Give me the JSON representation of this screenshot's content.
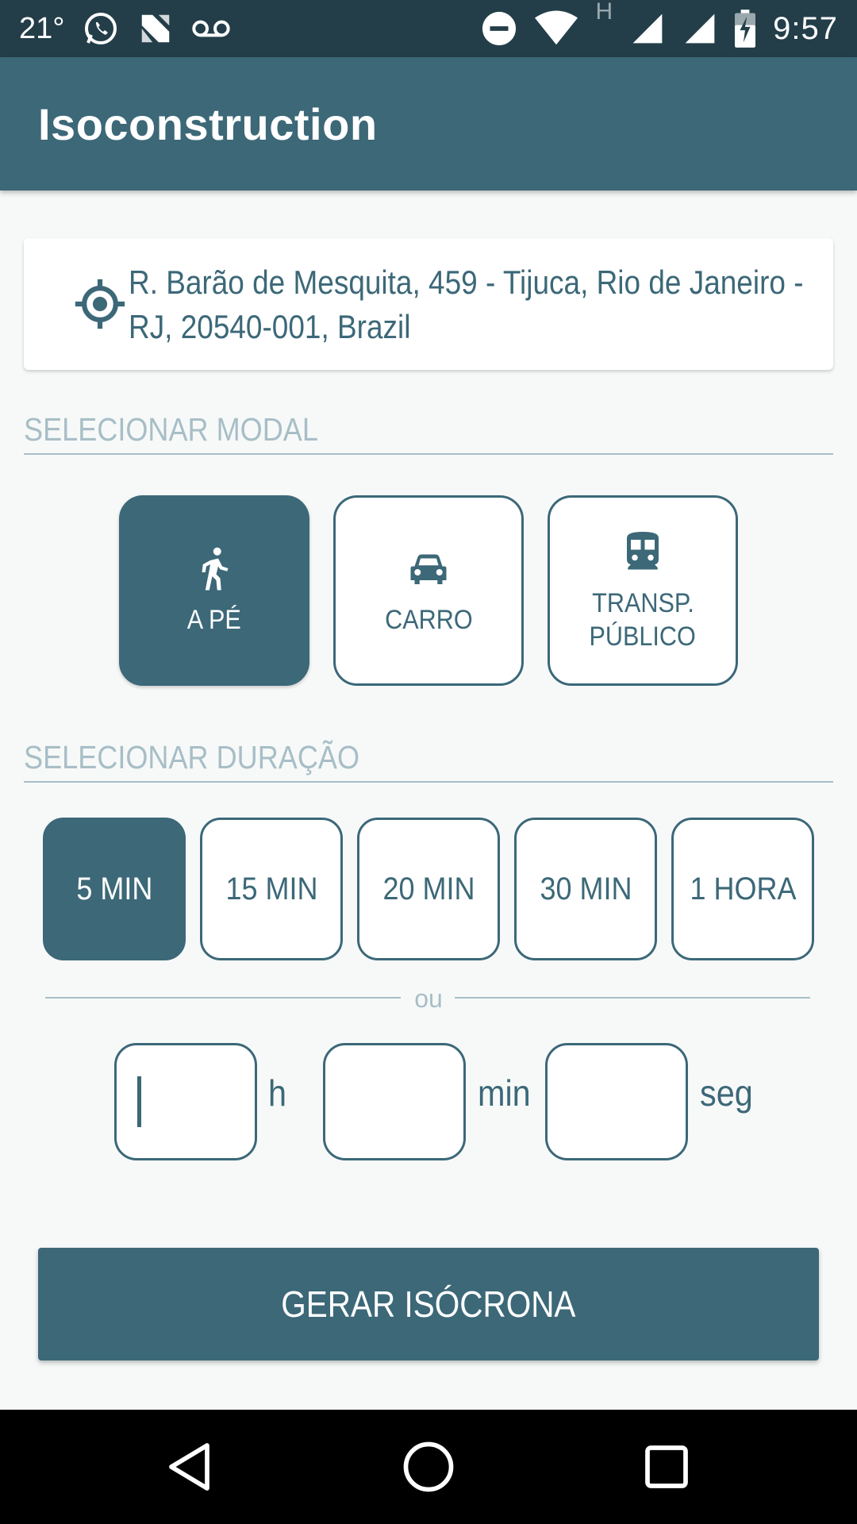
{
  "status_bar": {
    "temperature": "21°",
    "time": "9:57",
    "network_letter": "H",
    "icons": [
      "whatsapp-icon",
      "n-icon",
      "voicemail-icon",
      "dnd-icon",
      "wifi-icon",
      "signal-icon",
      "signal-icon-2",
      "battery-icon"
    ]
  },
  "app_bar": {
    "title": "Isoconstruction"
  },
  "address": {
    "value": "R. Barão de Mesquita, 459 - Tijuca, Rio de Janeiro - RJ, 20540-001, Brazil",
    "icon": "my-location-icon"
  },
  "modal_section": {
    "header": "SELECIONAR MODAL",
    "options": [
      {
        "label": "A PÉ",
        "icon": "walk-icon",
        "selected": true
      },
      {
        "label": "CARRO",
        "icon": "car-icon",
        "selected": false
      },
      {
        "label": "TRANSP. PÚBLICO",
        "label_line1": "TRANSP.",
        "label_line2": "PÚBLICO",
        "icon": "train-icon",
        "selected": false
      }
    ]
  },
  "duration_section": {
    "header": "SELECIONAR DURAÇÃO",
    "options": [
      {
        "label": "5 MIN",
        "selected": true
      },
      {
        "label": "15 MIN",
        "selected": false
      },
      {
        "label": "20 MIN",
        "selected": false
      },
      {
        "label": "30 MIN",
        "selected": false
      },
      {
        "label": "1 HORA",
        "selected": false
      }
    ],
    "or_text": "ou",
    "custom": {
      "hours_value": "",
      "hours_unit": "h",
      "minutes_value": "",
      "minutes_unit": "min",
      "seconds_value": "",
      "seconds_unit": "seg"
    }
  },
  "generate_button": {
    "label": "GERAR ISÓCRONA"
  },
  "nav_bar": {
    "icons": [
      "back-icon",
      "home-icon",
      "recents-icon"
    ]
  },
  "colors": {
    "primary": "#3c6878",
    "status_bar": "#233e49",
    "muted": "#a8bec6",
    "background": "#f7f9f9"
  }
}
